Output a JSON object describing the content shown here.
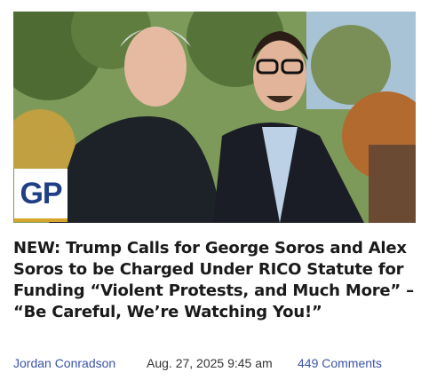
{
  "article": {
    "image_alt": "George Soros and Alex Soros",
    "badge": "GP",
    "headline": "NEW: Trump Calls for George Soros and Alex Soros to be Charged Under RICO Statute for Funding “Violent Protests, and Much More” – “Be Careful, We’re Watching You!”",
    "author": "Jordan Conradson",
    "date": "Aug. 27, 2025 9:45 am",
    "comments": "449 Comments"
  },
  "colors": {
    "link": "#3a55a8",
    "badge_blue": "#1f3e86",
    "badge_gold": "#d4a72c",
    "text": "#1a1a1a"
  }
}
